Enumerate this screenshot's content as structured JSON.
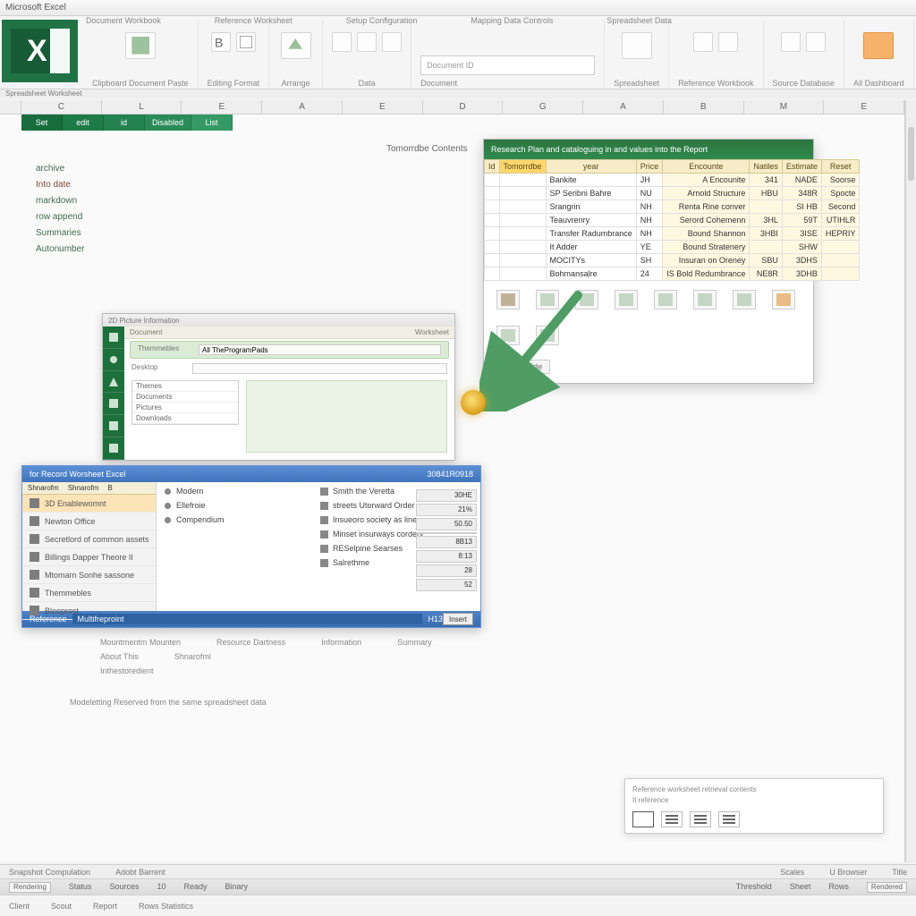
{
  "title": "Microsoft Excel",
  "ribbon_tabs": [
    "Document Workbook",
    "Reference Worksheet",
    "Setup Configuration",
    "Mapping Data Controls",
    "Spreadsheet Data"
  ],
  "ribbon_groups": [
    {
      "label": "Clipboard Document Paste"
    },
    {
      "label": "Editing Format"
    },
    {
      "label": "Arrange"
    },
    {
      "label": "Data"
    },
    {
      "label": "Document",
      "search_placeholder": "Document ID"
    },
    {
      "label": "Spreadsheet"
    },
    {
      "label": "Reference Workbook"
    },
    {
      "label": "Source Database"
    },
    {
      "label": "All Dashboard"
    }
  ],
  "second_title": "Spreadsheet Worksheet",
  "columns": [
    "C",
    "L",
    "E",
    "A",
    "E",
    "D",
    "G",
    "A",
    "B",
    "M",
    "E"
  ],
  "tabs": [
    "Set",
    "edit",
    "id",
    "Disabled",
    "List"
  ],
  "left_items": [
    "archive",
    "Into date",
    "markdown",
    "row append",
    "Summaries",
    "Autonumber"
  ],
  "center_label": "Tomorrdbe Contents",
  "data_panel": {
    "title": "Research Plan and cataloguing in and values into the Report",
    "headers": [
      "Id",
      "Tomorrdbe",
      "year",
      "Price",
      "Encounte",
      "Natiles",
      "Estimate",
      "Reset"
    ],
    "rows": [
      [
        "",
        "Bankite",
        "JH",
        "A Encounite",
        "341",
        "NADE",
        "Soorse"
      ],
      [
        "",
        "SP Seribni Bahre",
        "NU",
        "Arnold Structure",
        "HBU",
        "348R",
        "Spocte"
      ],
      [
        "",
        "Srangrin",
        "NH",
        "Renta Rine conver",
        "",
        "SI HB",
        "Second"
      ],
      [
        "",
        "Teauvrenry",
        "NH",
        "Serord Cohemenn",
        "3HL",
        "59T",
        "UTIHLR"
      ],
      [
        "",
        "Transfer Radumbrance",
        "NH",
        "Bound Shannon",
        "3HBI",
        "3ISE",
        "HEPRIY"
      ],
      [
        "",
        "It Adder",
        "YE",
        "Bound Stratenery",
        "",
        "SHW",
        ""
      ],
      [
        "",
        "MOCITYs",
        "SH",
        "Insuran on Oreney",
        "SBU",
        "3DHS",
        ""
      ],
      [
        "",
        "Bohmansalre",
        "24",
        "IS Bold Redumbrance",
        "NE8R",
        "3DHB",
        ""
      ]
    ],
    "chip": "2PL Inside"
  },
  "mini_excel": {
    "top": "2D Picture Information",
    "path_left": "Document",
    "path_right": "Worksheet",
    "row1_label": "Themmebles",
    "row1_value": "All TheProgramPads",
    "row2_label": "Desktop",
    "list": [
      "Themes",
      "Documents",
      "Pictures",
      "Downloads"
    ]
  },
  "blue_dialog": {
    "title": "for Record Worsheet Excel",
    "title_right": "30841R0918",
    "tabs": [
      "Shnarofm",
      "Shnarofm",
      "B"
    ],
    "left": [
      "3D Enablewomnt",
      "Newton Office",
      "Secretlord of common assets",
      "Billings Dapper Theore II",
      "Mtomarn Sonhe sassone",
      "Themmebles",
      "Blooprest"
    ],
    "left_sel_index": 0,
    "col1": [
      "Modern",
      "Ellefroie",
      "Compendium"
    ],
    "col2": [
      "Smith the Veretta",
      "streets Utorward Order",
      "Insueoro society as line",
      "Minset insurways cordery",
      "RESelpine Searses",
      "Salrethme"
    ],
    "mini": [
      "30HE",
      "21%",
      "50.50",
      "",
      "8B13",
      "8:13",
      "28",
      "52"
    ],
    "footer_label": "Reference",
    "footer_input": "Multifreproint",
    "footer_num": "H13",
    "footer_btn": "Insert"
  },
  "below": {
    "rows": [
      [
        "Mountmentm Mounten",
        "Resource Dartness",
        "Information",
        "Summary"
      ],
      [
        "About This",
        "Shnarofmi"
      ],
      [
        "Inthestoredient"
      ]
    ],
    "sentence": "Modeletting Reserved from the same spreadsheet data"
  },
  "bottom_card": {
    "line1": "Reference worksheet retrieval contents",
    "line2": "It reference"
  },
  "status1": {
    "left": [
      "Snapshot Compulation",
      "Adobt Barrent"
    ],
    "right": [
      "Scales",
      "U Browser",
      "Title"
    ]
  },
  "status2": {
    "left": [
      "Rendering",
      "Status",
      "Sources",
      "10",
      "Ready",
      "Binary"
    ],
    "right": [
      "Threshold",
      "Sheet",
      "Rows",
      "Rendered"
    ]
  },
  "status3": [
    "Client",
    "Scout",
    "Report",
    "Rows Statistics"
  ]
}
